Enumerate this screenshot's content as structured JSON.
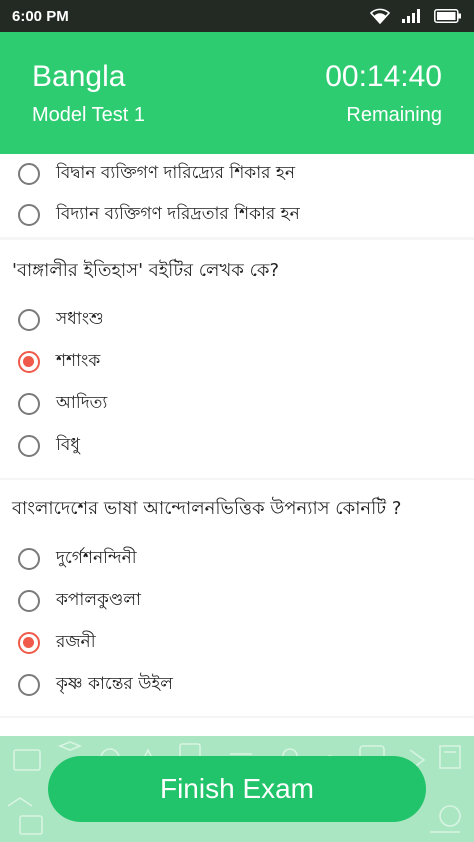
{
  "status_bar": {
    "time": "6:00 PM"
  },
  "header": {
    "subject": "Bangla",
    "test_name": "Model Test 1",
    "timer": "00:14:40",
    "timer_label": "Remaining"
  },
  "questions": [
    {
      "options": [
        {
          "label": "বিদ্বান ব্যক্তিগণ দারিদ্র্যের শিকার হন",
          "selected": false
        },
        {
          "label": "বিদ্যান ব্যক্তিগণ দরিদ্রতার শিকার হন",
          "selected": false
        }
      ]
    },
    {
      "text": "'বাঙ্গালীর ইতিহাস' বইটির লেখক কে?",
      "options": [
        {
          "label": "সধাংশু",
          "selected": false
        },
        {
          "label": "শশাংক",
          "selected": true
        },
        {
          "label": "আদিত্য",
          "selected": false
        },
        {
          "label": "বিধু",
          "selected": false
        }
      ]
    },
    {
      "text": "বাংলাদেশের ভাষা আন্দোলনভিত্তিক উপন্যাস কোনটি ?",
      "options": [
        {
          "label": "দুর্গেশনন্দিনী",
          "selected": false
        },
        {
          "label": "কপালকুণ্ডলা",
          "selected": false
        },
        {
          "label": "রজনী",
          "selected": true
        },
        {
          "label": "কৃষ্ণ কান্তের উইল",
          "selected": false
        }
      ]
    }
  ],
  "finish_button": {
    "label": "Finish Exam"
  },
  "colors": {
    "primary": "#2ecc71",
    "button": "#21c46a",
    "selected": "#f05a4a"
  }
}
